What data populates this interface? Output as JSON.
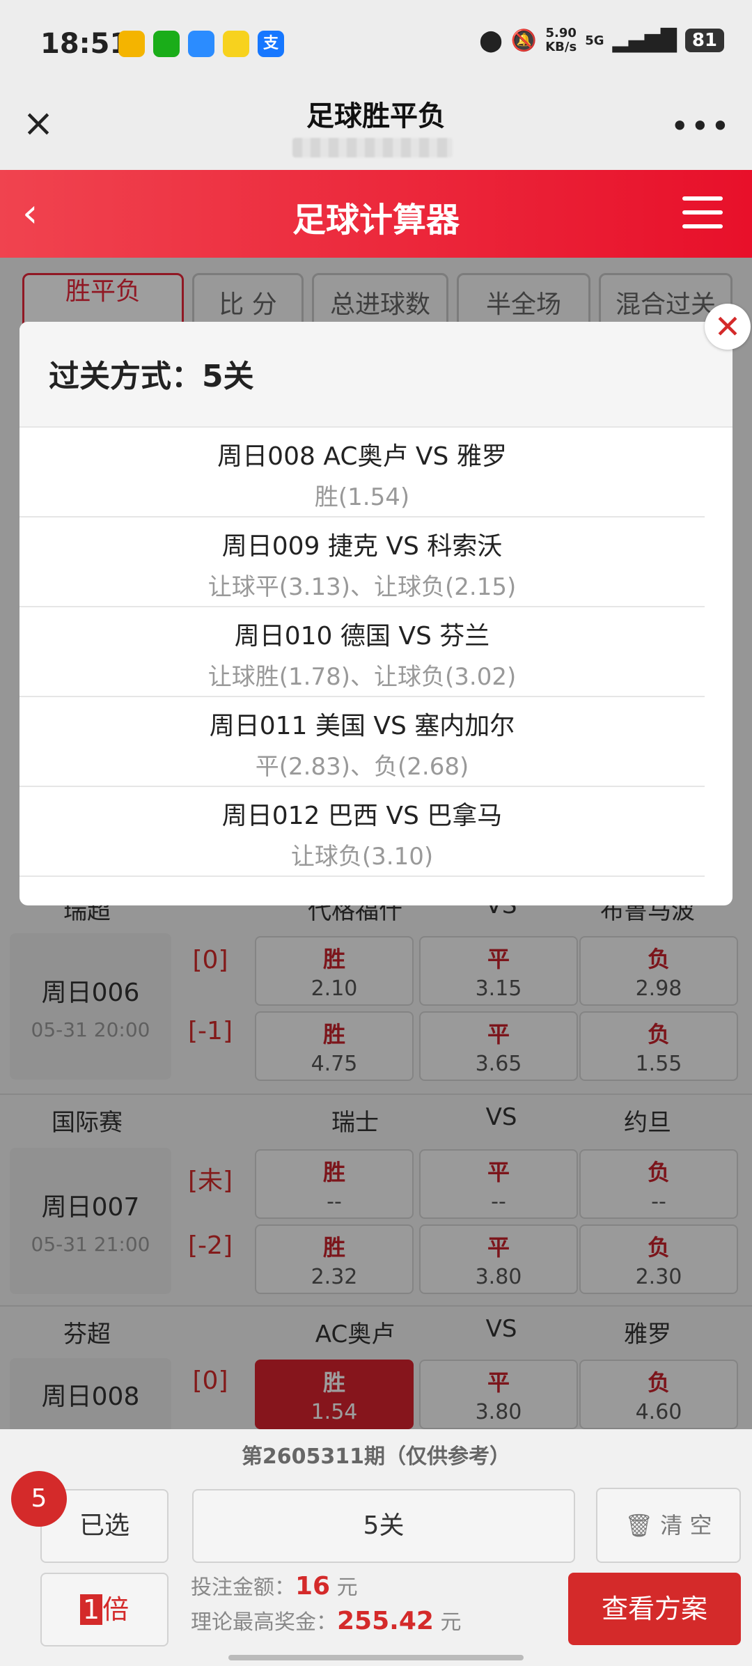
{
  "status_bar": {
    "time": "18:51",
    "net_speed": "5.90",
    "net_unit": "KB/s",
    "network": "5G",
    "battery": "81",
    "app_icons": [
      "folder-app-icon",
      "wechat-icon",
      "cloud-app-icon",
      "camera-app-icon",
      "alipay-icon"
    ],
    "alipay_glyph": "支"
  },
  "title_bar": {
    "title": "足球胜平负"
  },
  "header": {
    "title": "足球计算器"
  },
  "tabs": [
    {
      "label": "胜平负"
    },
    {
      "label": "比 分"
    },
    {
      "label": "总进球数"
    },
    {
      "label": "半全场"
    },
    {
      "label": "混合过关"
    }
  ],
  "matches": [
    {
      "league": "瑞超",
      "home": "代格福什",
      "vs": "VS",
      "away": "布鲁马波",
      "no": "周日006",
      "time": "05-31 20:00",
      "rows": [
        {
          "hcp": "[0]",
          "cells": [
            {
              "label": "胜",
              "odds": "2.10"
            },
            {
              "label": "平",
              "odds": "3.15"
            },
            {
              "label": "负",
              "odds": "2.98"
            }
          ]
        },
        {
          "hcp": "[-1]",
          "cells": [
            {
              "label": "胜",
              "odds": "4.75"
            },
            {
              "label": "平",
              "odds": "3.65"
            },
            {
              "label": "负",
              "odds": "1.55"
            }
          ]
        }
      ]
    },
    {
      "league": "国际赛",
      "home": "瑞士",
      "vs": "VS",
      "away": "约旦",
      "no": "周日007",
      "time": "05-31 21:00",
      "rows": [
        {
          "hcp": "[未]",
          "cells": [
            {
              "label": "胜",
              "odds": "--"
            },
            {
              "label": "平",
              "odds": "--"
            },
            {
              "label": "负",
              "odds": "--"
            }
          ]
        },
        {
          "hcp": "[-2]",
          "cells": [
            {
              "label": "胜",
              "odds": "2.32"
            },
            {
              "label": "平",
              "odds": "3.80"
            },
            {
              "label": "负",
              "odds": "2.30"
            }
          ]
        }
      ]
    },
    {
      "league": "芬超",
      "home": "AC奥卢",
      "vs": "VS",
      "away": "雅罗",
      "no": "周日008",
      "time": "",
      "rows": [
        {
          "hcp": "[0]",
          "cells": [
            {
              "label": "胜",
              "odds": "1.54",
              "selected": true
            },
            {
              "label": "平",
              "odds": "3.80"
            },
            {
              "label": "负",
              "odds": "4.60"
            }
          ]
        }
      ]
    }
  ],
  "modal": {
    "title": "过关方式：5关",
    "items": [
      {
        "match": "周日008 AC奥卢 VS 雅罗",
        "pick": "胜(1.54)"
      },
      {
        "match": "周日009 捷克 VS 科索沃",
        "pick": "让球平(3.13)、让球负(2.15)"
      },
      {
        "match": "周日010 德国 VS 芬兰",
        "pick": "让球胜(1.78)、让球负(3.02)"
      },
      {
        "match": "周日011 美国 VS 塞内加尔",
        "pick": "平(2.83)、负(2.68)"
      },
      {
        "match": "周日012 巴西 VS 巴拿马",
        "pick": "让球负(3.10)"
      }
    ],
    "close_glyph": "✕"
  },
  "bottom": {
    "period": "第2605311期（仅供参考）",
    "selected_count": "5",
    "selected_label": "已选",
    "pass_mode": "5关",
    "clear_label": "清 空",
    "multiplier_num": "1",
    "multiplier_unit": "倍",
    "bet_label": "投注金额：",
    "bet_amount": "16",
    "bet_unit": "元",
    "max_label": "理论最高奖金：",
    "max_amount": "255.42",
    "max_unit": "元",
    "view_button": "查看方案"
  },
  "colors": {
    "accent": "#d42a2a",
    "header_gradient_start": "#f0434f",
    "header_gradient_end": "#e8102a"
  }
}
